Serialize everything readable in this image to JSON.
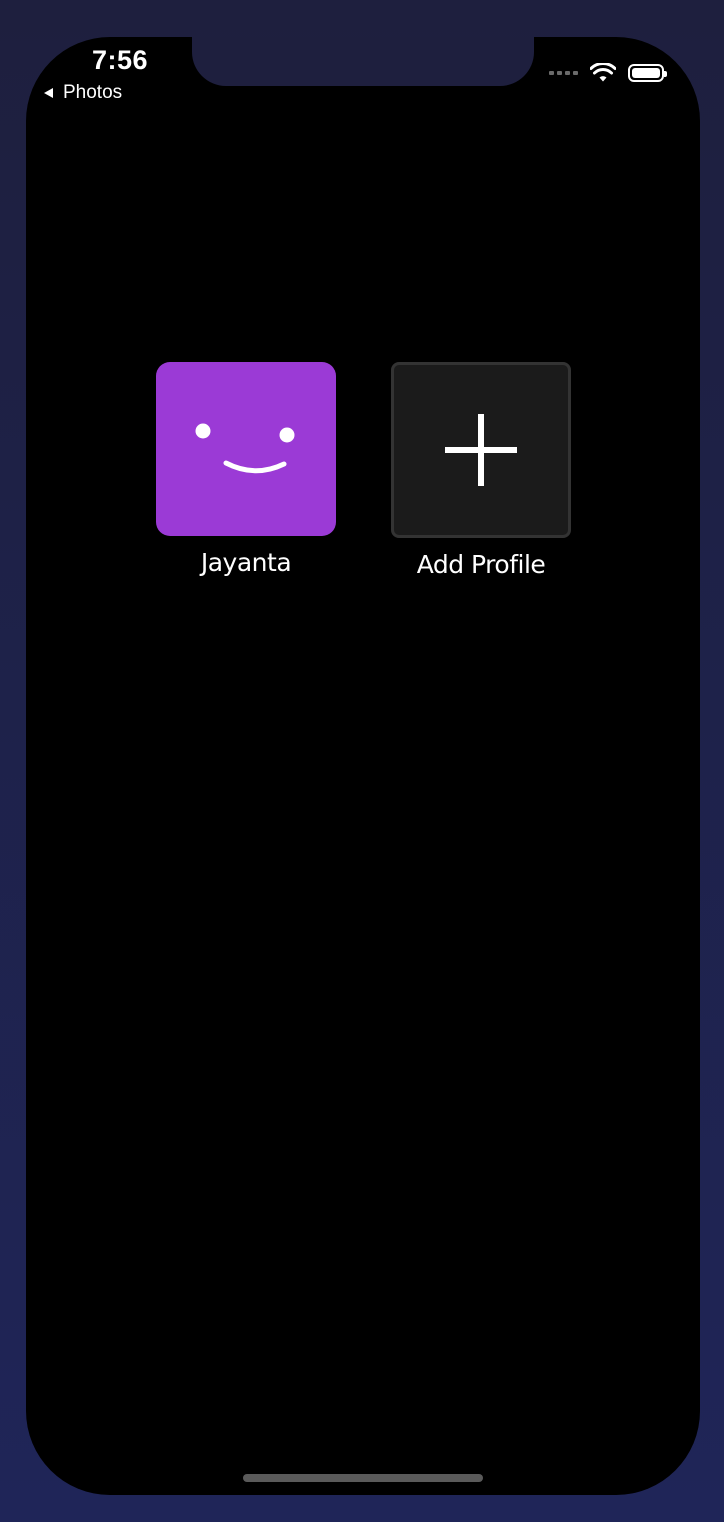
{
  "status_bar": {
    "time": "7:56",
    "back_label": "Photos"
  },
  "profiles": [
    {
      "name": "Jayanta",
      "avatar_color": "#9b3ad6",
      "icon": "smiley-face-icon"
    },
    {
      "name": "Add Profile",
      "icon": "plus-icon"
    }
  ],
  "colors": {
    "background": "#000000",
    "avatar_purple": "#9b3ad6",
    "add_tile": "#1b1b1b"
  }
}
